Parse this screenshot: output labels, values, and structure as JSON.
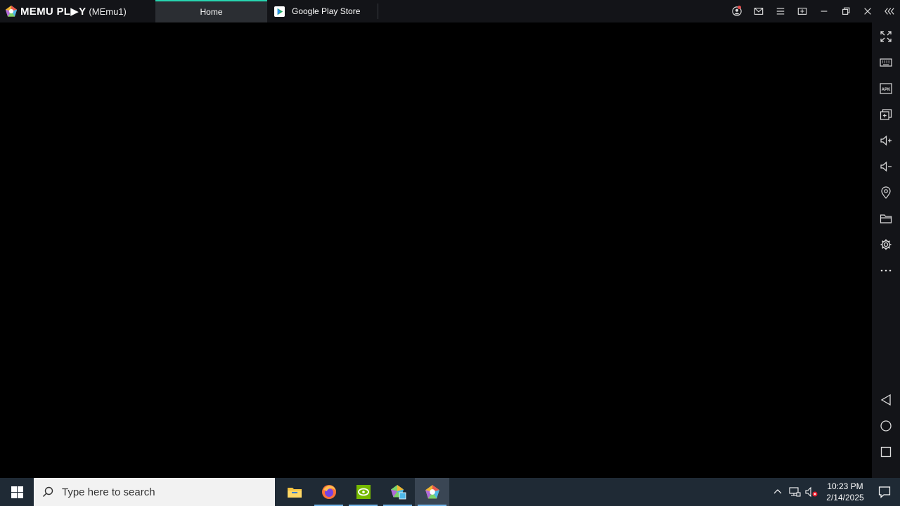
{
  "app": {
    "brand": "MEMU PL▶Y",
    "instance": "(MEmu1)"
  },
  "tabs": [
    {
      "label": "Home",
      "active": true
    },
    {
      "label": "Google Play Store",
      "active": false
    }
  ],
  "title_actions": [
    "account-icon",
    "mail-icon",
    "menu-icon",
    "multi-window-icon",
    "minimize-icon",
    "restore-icon",
    "close-icon",
    "collapse-sidebar-icon"
  ],
  "sidebar": {
    "top": [
      "fullscreen-icon",
      "keyboard-icon",
      "apk-icon",
      "add-window-icon",
      "volume-up-icon",
      "volume-down-icon",
      "location-icon",
      "folder-icon",
      "settings-icon",
      "more-icon"
    ],
    "bottom": [
      "back-icon",
      "home-icon",
      "recents-icon"
    ]
  },
  "taskbar": {
    "search_placeholder": "Type here to search",
    "apps": [
      "file-explorer-icon",
      "firefox-icon",
      "nvidia-icon",
      "memu-multi-icon",
      "memu-icon"
    ],
    "time": "10:23 PM",
    "date": "2/14/2025"
  },
  "colors": {
    "accent": "#27d4b0",
    "titlebar": "#131418",
    "taskbar": "#1f2a35"
  }
}
